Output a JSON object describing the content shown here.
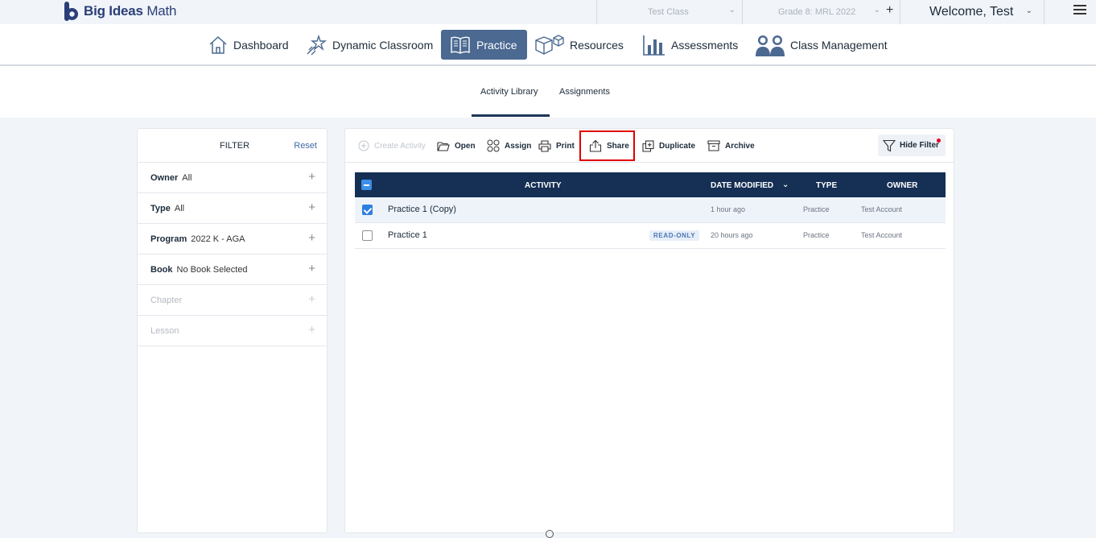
{
  "topbar": {
    "brand_bold": "Big Ideas",
    "brand_light": "Math",
    "class_select": "Test Class",
    "grade_select": "Grade 8: MRL 2022",
    "add_symbol": "+",
    "welcome": "Welcome, Test"
  },
  "nav": {
    "items": [
      {
        "label": "Dashboard",
        "icon": "house-icon"
      },
      {
        "label": "Dynamic Classroom",
        "icon": "star-wand-icon"
      },
      {
        "label": "Practice",
        "icon": "open-book-icon",
        "active": true
      },
      {
        "label": "Resources",
        "icon": "cubes-icon"
      },
      {
        "label": "Assessments",
        "icon": "bar-chart-icon"
      },
      {
        "label": "Class Management",
        "icon": "people-icon"
      }
    ]
  },
  "subnav": {
    "tabs": [
      {
        "label": "Activity Library",
        "active": true
      },
      {
        "label": "Assignments",
        "active": false
      }
    ]
  },
  "filter": {
    "title": "FILTER",
    "reset": "Reset",
    "rows": [
      {
        "label": "Owner",
        "value": "All",
        "enabled": true
      },
      {
        "label": "Type",
        "value": "All",
        "enabled": true
      },
      {
        "label": "Program",
        "value": "2022 K - AGA",
        "enabled": true
      },
      {
        "label": "Book",
        "value": "No Book Selected",
        "enabled": true
      },
      {
        "label": "Chapter",
        "value": "",
        "enabled": false
      },
      {
        "label": "Lesson",
        "value": "",
        "enabled": false
      }
    ]
  },
  "toolbar": {
    "create": "Create Activity",
    "open": "Open",
    "assign": "Assign",
    "print": "Print",
    "share": "Share",
    "duplicate": "Duplicate",
    "archive": "Archive",
    "hide_filter": "Hide Filter",
    "highlighted": "Share"
  },
  "table": {
    "columns": [
      "ACTIVITY",
      "DATE MODIFIED",
      "TYPE",
      "OWNER"
    ],
    "rows": [
      {
        "name": "Practice 1 (Copy)",
        "badge": "",
        "date": "1 hour ago",
        "type": "Practice",
        "owner": "Test Account",
        "checked": true
      },
      {
        "name": "Practice 1",
        "badge": "READ-ONLY",
        "date": "20 hours ago",
        "type": "Practice",
        "owner": "Test Account",
        "checked": false
      }
    ]
  },
  "colors": {
    "brand_navy": "#152f55",
    "active_tab_bg": "#4b6991",
    "highlight_red": "#e00000",
    "link_blue": "#3f6aa8"
  }
}
